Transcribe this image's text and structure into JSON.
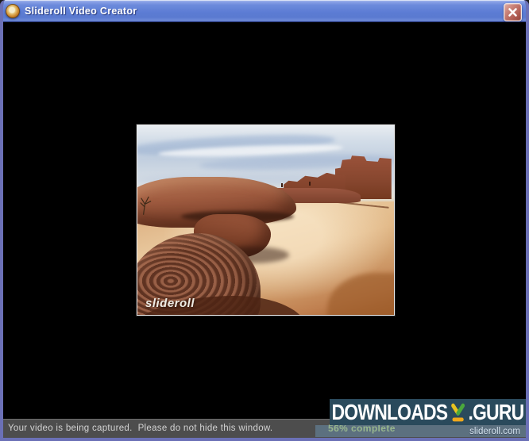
{
  "window": {
    "title": "Slideroll Video Creator",
    "icons": {
      "app": "disc-icon",
      "close": "close-x-icon"
    }
  },
  "photo": {
    "watermark": "slideroll",
    "description": "desert canyon scene with red sandstone rocks and pueblo ruins under a blue streaked sky"
  },
  "statusbar": {
    "message": "Your video is being captured.  Please do not hide this window.",
    "progress": "56% complete"
  },
  "overlay": {
    "brand_left": "DOWNLOADS",
    "brand_right": ".GURU",
    "site": "slideroll.com",
    "icon": "download-arrow-icon"
  },
  "colors": {
    "titlebar_blue": "#5c7cd4",
    "window_border": "#6b70b6",
    "statusbar_gray": "#4d4d4d",
    "progress_green": "#c2d96a",
    "overlay_teal": "#2a4a5c",
    "close_red": "#b05c52",
    "arrow_yellow": "#e8c21f",
    "arrow_green": "#4aa83c",
    "arrow_bar_orange": "#f0a81c"
  }
}
